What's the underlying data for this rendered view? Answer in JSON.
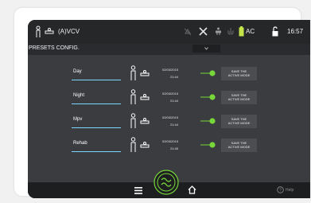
{
  "status_bar": {
    "mode": "(A)VCV",
    "ac_label": "AC",
    "time": "16:57"
  },
  "title_bar": {
    "title": "PRESETS CONFIG."
  },
  "presets": [
    {
      "name": "Day",
      "date": "02/03/2015",
      "time": "21:44",
      "save_line1": "SAVE THE",
      "save_line2": "ACTIVE MODE"
    },
    {
      "name": "Night",
      "date": "02/03/2015",
      "time": "21:44",
      "save_line1": "SAVE THE",
      "save_line2": "ACTIVE MODE"
    },
    {
      "name": "Mpv",
      "date": "02/03/2015",
      "time": "21:44",
      "save_line1": "SAVE THE",
      "save_line2": "ACTIVE MODE"
    },
    {
      "name": "Rehab",
      "date": "02/03/2015",
      "time": "21:45",
      "save_line1": "SAVE THE",
      "save_line2": "ACTIVE MODE"
    }
  ],
  "bottom_bar": {
    "help": "Help"
  },
  "colors": {
    "accent_green": "#77d63a",
    "input_underline": "#7bd5ff"
  },
  "icons": [
    "patient-icon",
    "bed-icon",
    "alarm-off-icon",
    "tools-icon",
    "person-icon",
    "lungs-icon",
    "battery-icon",
    "lock-icon",
    "menu-icon",
    "ventilator-icon",
    "home-icon",
    "help-icon",
    "chevron-down-icon"
  ]
}
